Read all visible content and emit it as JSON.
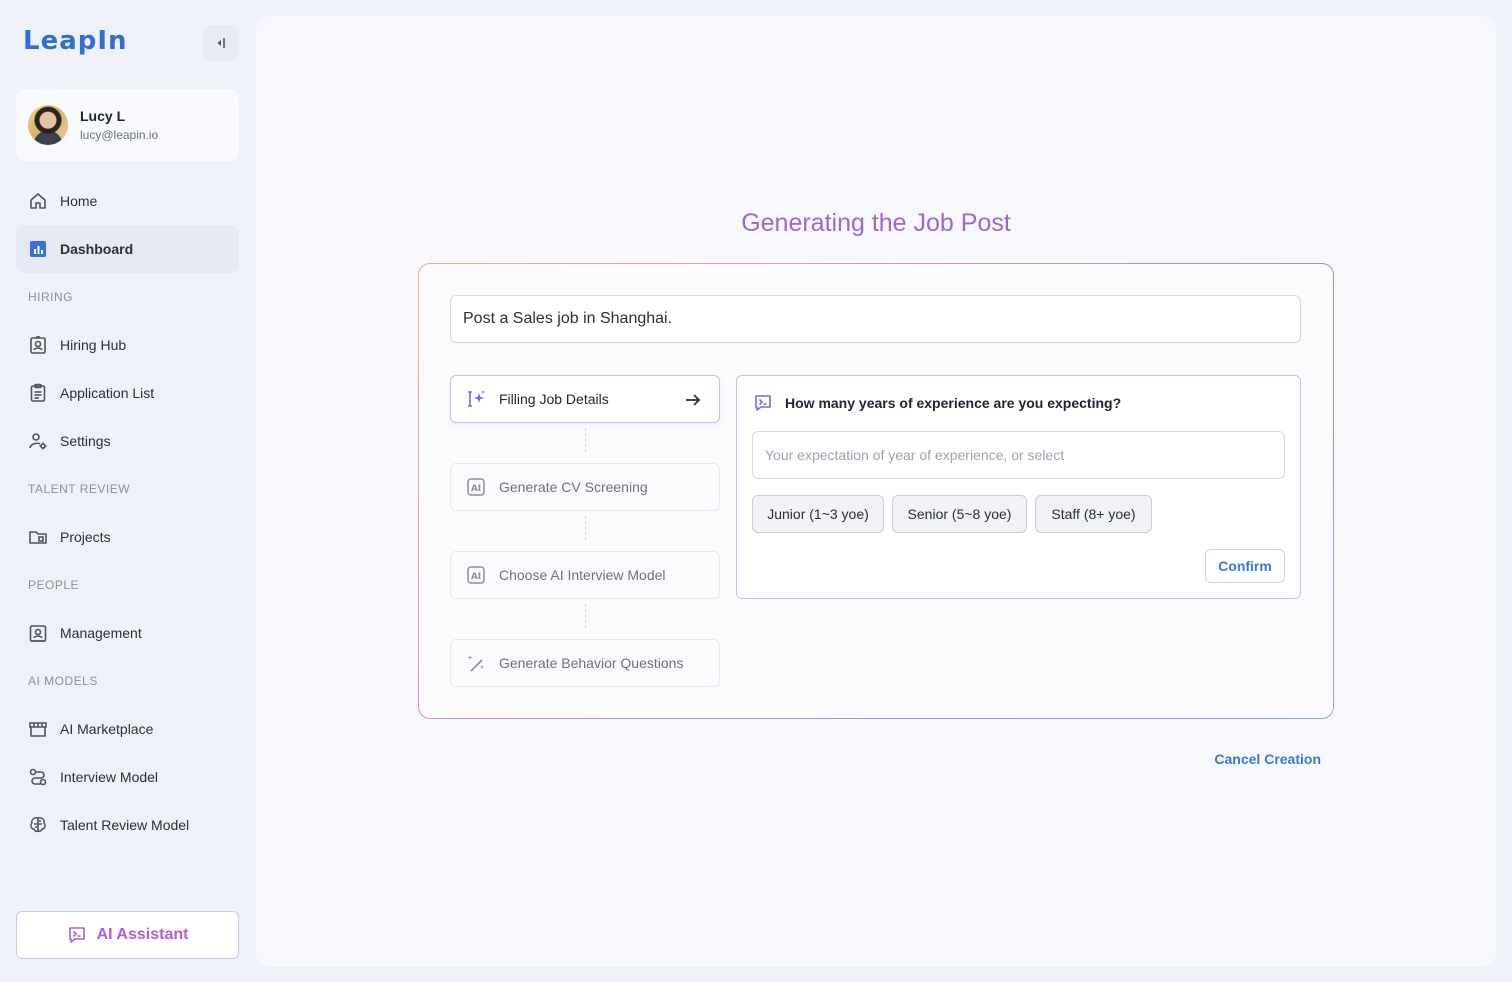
{
  "app": {
    "logo": "LeapIn"
  },
  "user": {
    "name": "Lucy L",
    "email": "lucy@leapin.io"
  },
  "nav": {
    "home": "Home",
    "dashboard": "Dashboard",
    "hiring_section": "HIRING",
    "hiring_hub": "Hiring Hub",
    "application_list": "Application List",
    "settings": "Settings",
    "talent_section": "TALENT REVIEW",
    "projects": "Projects",
    "people_section": "PEOPLE",
    "management": "Management",
    "ai_section": "AI MODELS",
    "ai_marketplace": "AI Marketplace",
    "interview_model": "Interview Model",
    "talent_review_model": "Talent Review Model",
    "active_item": "Dashboard"
  },
  "ai_assistant": {
    "label": "AI Assistant"
  },
  "main": {
    "title": "Generating the Job Post",
    "prompt": "Post a Sales job in Shanghai.",
    "steps": [
      {
        "label": "Filling Job Details",
        "icon": "sparkle-cursor-icon",
        "state": "current"
      },
      {
        "label": "Generate CV Screening",
        "icon": "ai-badge-icon",
        "state": "pending"
      },
      {
        "label": "Choose AI Interview Model",
        "icon": "ai-badge-icon",
        "state": "pending"
      },
      {
        "label": "Generate Behavior Questions",
        "icon": "magic-wand-icon",
        "state": "pending"
      }
    ],
    "question": {
      "text": "How many years of experience are you expecting?",
      "input_placeholder": "Your expectation of year of experience, or select",
      "options": [
        "Junior (1~3 yoe)",
        "Senior (5~8 yoe)",
        "Staff (8+ yoe)"
      ],
      "confirm_label": "Confirm"
    },
    "cancel_label": "Cancel Creation"
  },
  "colors": {
    "accent_blue": "#3b78d6",
    "title_purple": "#a066d8",
    "assistant_pink": "#b45bd8"
  }
}
